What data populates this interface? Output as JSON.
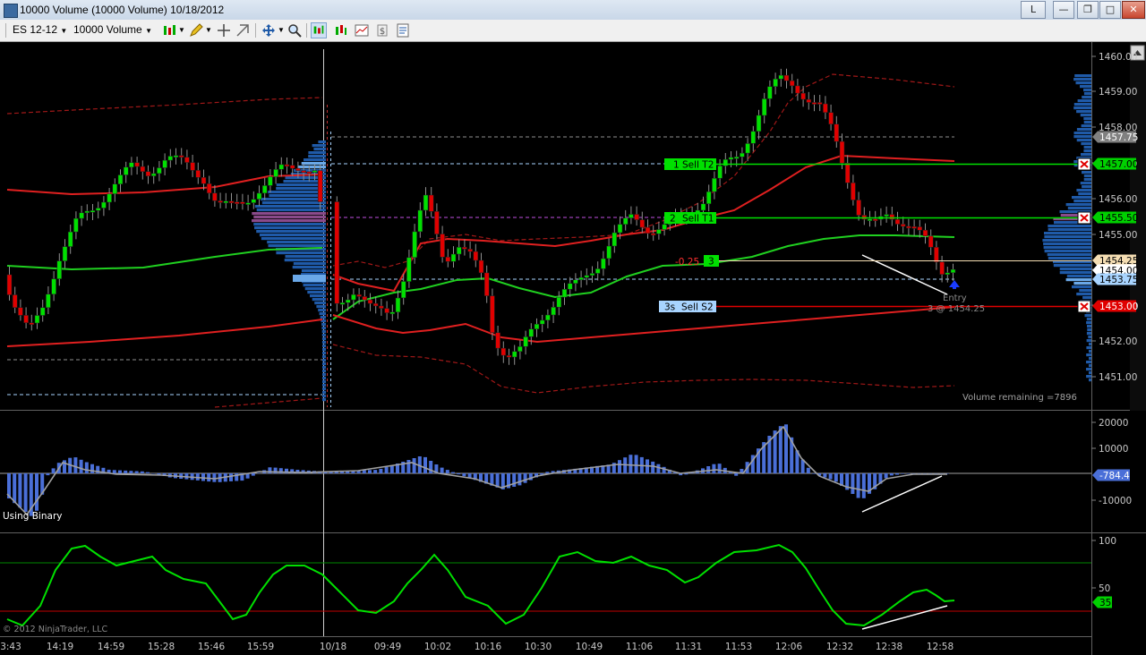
{
  "window": {
    "title": "10000 Volume (10000 Volume)  10/18/2012",
    "lock_label": "L",
    "minimize_glyph": "—",
    "restore_glyph": "❐",
    "maximize_glyph": "□",
    "close_glyph": "✕"
  },
  "toolbar": {
    "instrument": "ES 12-12",
    "period": "10000 Volume"
  },
  "price_axis": {
    "ticks": [
      "1460.00",
      "1459.00",
      "1458.00",
      "1457.00",
      "1456.00",
      "1455.00",
      "1454.00",
      "1453.00",
      "1452.00",
      "1451.00"
    ],
    "badges": [
      {
        "label": "1457.75",
        "bg": "#808080",
        "fg": "#ffffff"
      },
      {
        "label": "1457.00",
        "bg": "#00d000",
        "fg": "#000000"
      },
      {
        "label": "1455.50",
        "bg": "#00d000",
        "fg": "#000000"
      },
      {
        "label": "1454.25",
        "bg": "#f5deb3",
        "fg": "#000000"
      },
      {
        "label": "1454.00",
        "bg": "#ffffff",
        "fg": "#000000"
      },
      {
        "label": "1453.75",
        "bg": "#a8d4ff",
        "fg": "#000000"
      },
      {
        "label": "1453.00",
        "bg": "#e00000",
        "fg": "#ffffff"
      }
    ]
  },
  "orders": {
    "target2": {
      "qty": "1",
      "label": "Sell T2"
    },
    "target1": {
      "qty": "2",
      "label": "Sell T1"
    },
    "position": {
      "pnl": "-0.25",
      "qty": "3"
    },
    "stop": {
      "qty": "3s",
      "label": "Sell S2"
    },
    "entry_label": "Entry",
    "entry_fill": "3 @ 1454.25"
  },
  "volume_remaining": "Volume remaining =7896",
  "indicator1": {
    "label": "Using Binary",
    "ticks": [
      "20000",
      "10000",
      "-10000"
    ],
    "value_badge": "-784.4",
    "bar_color": "#4a6fd8",
    "line_color": "#a0a0a0"
  },
  "indicator2": {
    "ticks": [
      "100",
      "50"
    ],
    "value_badge": "35",
    "line_color": "#00e000"
  },
  "copyright": "© 2012 NinjaTrader, LLC",
  "time_axis": [
    "3:43",
    "14:19",
    "14:59",
    "15:28",
    "15:46",
    "15:59",
    "10/18",
    "09:49",
    "10:02",
    "10:16",
    "10:30",
    "10:49",
    "11:06",
    "11:31",
    "11:53",
    "12:06",
    "12:32",
    "12:38",
    "12:58"
  ],
  "colors": {
    "up_candle": "#00e000",
    "down_candle": "#e00000",
    "target_line": "#00e000",
    "stop_line": "#e00000",
    "entry_line": "#f5deb3",
    "profile_bar": "#1f5aa8"
  }
}
